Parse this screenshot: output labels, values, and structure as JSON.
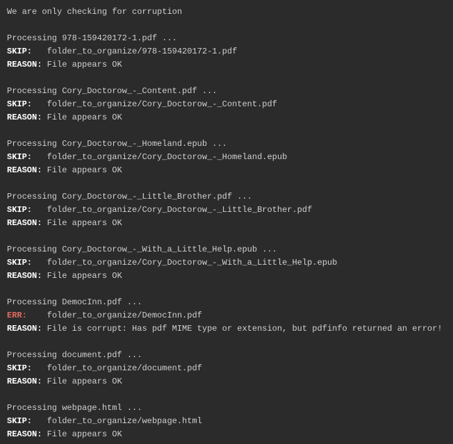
{
  "terminal": {
    "intro": "We are only checking for corruption",
    "entries": [
      {
        "processing": "Processing 978-159420172-1.pdf ...",
        "status": "SKIP",
        "status_label": "SKIP:",
        "path": "folder_to_organize/978-159420172-1.pdf",
        "reason_label": "REASON:",
        "reason": "File appears OK"
      },
      {
        "processing": "Processing Cory_Doctorow_-_Content.pdf ...",
        "status": "SKIP",
        "status_label": "SKIP:",
        "path": "folder_to_organize/Cory_Doctorow_-_Content.pdf",
        "reason_label": "REASON:",
        "reason": "File appears OK"
      },
      {
        "processing": "Processing Cory_Doctorow_-_Homeland.epub ...",
        "status": "SKIP",
        "status_label": "SKIP:",
        "path": "folder_to_organize/Cory_Doctorow_-_Homeland.epub",
        "reason_label": "REASON:",
        "reason": "File appears OK"
      },
      {
        "processing": "Processing Cory_Doctorow_-_Little_Brother.pdf ...",
        "status": "SKIP",
        "status_label": "SKIP:",
        "path": "folder_to_organize/Cory_Doctorow_-_Little_Brother.pdf",
        "reason_label": "REASON:",
        "reason": "File appears OK"
      },
      {
        "processing": "Processing Cory_Doctorow_-_With_a_Little_Help.epub ...",
        "status": "SKIP",
        "status_label": "SKIP:",
        "path": "folder_to_organize/Cory_Doctorow_-_With_a_Little_Help.epub",
        "reason_label": "REASON:",
        "reason": "File appears OK"
      },
      {
        "processing": "Processing DemocInn.pdf ...",
        "status": "ERR",
        "status_label": "ERR:",
        "path": "folder_to_organize/DemocInn.pdf",
        "reason_label": "REASON:",
        "reason": "File is corrupt: Has pdf MIME type or extension, but pdfinfo returned an error!"
      },
      {
        "processing": "Processing document.pdf ...",
        "status": "SKIP",
        "status_label": "SKIP:",
        "path": "folder_to_organize/document.pdf",
        "reason_label": "REASON:",
        "reason": "File appears OK"
      },
      {
        "processing": "Processing webpage.html ...",
        "status": "SKIP",
        "status_label": "SKIP:",
        "path": "folder_to_organize/webpage.html",
        "reason_label": "REASON:",
        "reason": "File appears OK"
      }
    ]
  }
}
